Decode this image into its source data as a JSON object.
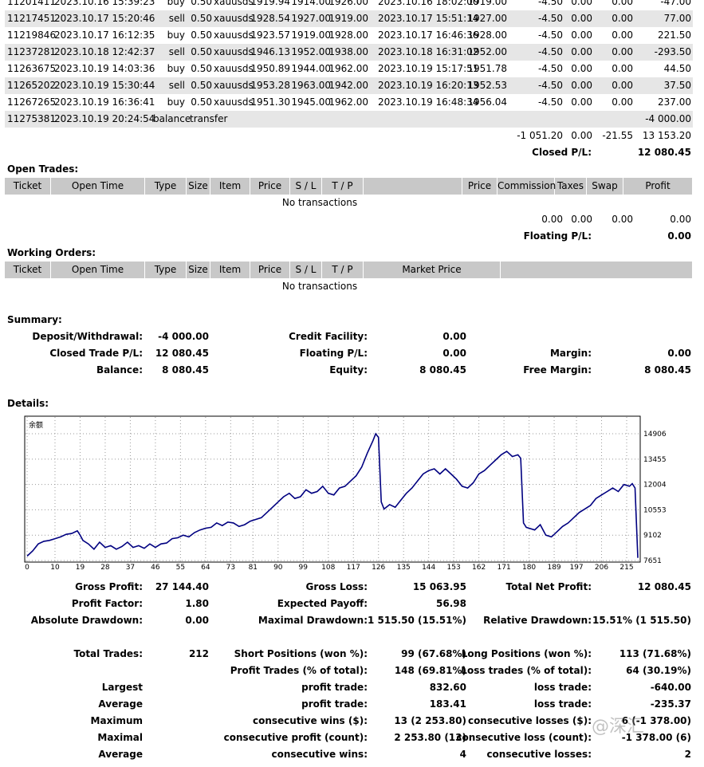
{
  "closed_rows": [
    [
      "11201411",
      "2023.10.16 15:39:23",
      "buy",
      "0.50",
      "xauusds",
      "1919.94",
      "1914.00",
      "1926.00",
      "2023.10.16 18:02:00",
      "1919.00",
      "-4.50",
      "0.00",
      "0.00",
      "-47.00"
    ],
    [
      "11217451",
      "2023.10.17 15:20:46",
      "sell",
      "0.50",
      "xauusds",
      "1928.54",
      "1927.00",
      "1919.00",
      "2023.10.17 15:51:14",
      "1927.00",
      "-4.50",
      "0.00",
      "0.00",
      "77.00"
    ],
    [
      "11219846",
      "2023.10.17 16:12:35",
      "buy",
      "0.50",
      "xauusds",
      "1923.57",
      "1919.00",
      "1928.00",
      "2023.10.17 16:46:36",
      "1928.00",
      "-4.50",
      "0.00",
      "0.00",
      "221.50"
    ],
    [
      "11237281",
      "2023.10.18 12:42:37",
      "sell",
      "0.50",
      "xauusds",
      "1946.13",
      "1952.00",
      "1938.00",
      "2023.10.18 16:31:02",
      "1952.00",
      "-4.50",
      "0.00",
      "0.00",
      "-293.50"
    ],
    [
      "11263675",
      "2023.10.19 14:03:36",
      "buy",
      "0.50",
      "xauusds",
      "1950.89",
      "1944.00",
      "1962.00",
      "2023.10.19 15:17:51",
      "1951.78",
      "-4.50",
      "0.00",
      "0.00",
      "44.50"
    ],
    [
      "11265202",
      "2023.10.19 15:30:44",
      "sell",
      "0.50",
      "xauusds",
      "1953.28",
      "1963.00",
      "1942.00",
      "2023.10.19 16:20:13",
      "1952.53",
      "-4.50",
      "0.00",
      "0.00",
      "37.50"
    ],
    [
      "11267265",
      "2023.10.19 16:36:41",
      "buy",
      "0.50",
      "xauusds",
      "1951.30",
      "1945.00",
      "1962.00",
      "2023.10.19 16:48:34",
      "1956.04",
      "-4.50",
      "0.00",
      "0.00",
      "237.00"
    ]
  ],
  "balance_row": {
    "ticket": "11275381",
    "time": "2023.10.19 20:24:54",
    "type": "balance",
    "item": "transfer",
    "profit": "-4 000.00"
  },
  "closed_totals": {
    "commission": "-1 051.20",
    "taxes": "0.00",
    "swap": "-21.55",
    "profit": "13 153.20"
  },
  "closed_pl": {
    "label": "Closed P/L:",
    "value": "12 080.45"
  },
  "open_trades": {
    "title": "Open Trades:",
    "headers": [
      "Ticket",
      "Open Time",
      "Type",
      "Size",
      "Item",
      "Price",
      "S / L",
      "T / P",
      "",
      "Price",
      "Commission",
      "Taxes",
      "Swap",
      "Profit"
    ],
    "empty": "No transactions",
    "totals": {
      "commission": "0.00",
      "taxes": "0.00",
      "swap": "0.00",
      "profit": "0.00"
    },
    "floating_label": "Floating P/L:",
    "floating_value": "0.00"
  },
  "working_orders": {
    "title": "Working Orders:",
    "headers": [
      "Ticket",
      "Open Time",
      "Type",
      "Size",
      "Item",
      "Price",
      "S / L",
      "T / P",
      "Market Price",
      ""
    ],
    "empty": "No transactions"
  },
  "summary": {
    "title": "Summary:",
    "deposit_label": "Deposit/Withdrawal:",
    "deposit": "-4 000.00",
    "credit_label": "Credit Facility:",
    "credit": "0.00",
    "closed_label": "Closed Trade P/L:",
    "closed": "12 080.45",
    "floating_label": "Floating P/L:",
    "floating": "0.00",
    "margin_label": "Margin:",
    "margin": "0.00",
    "balance_label": "Balance:",
    "balance": "8 080.45",
    "equity_label": "Equity:",
    "equity": "8 080.45",
    "free_margin_label": "Free Margin:",
    "free_margin": "8 080.45"
  },
  "details_title": "Details:",
  "chart_data": {
    "type": "line",
    "title": "余额",
    "y_ticks": [
      "14906",
      "13455",
      "12004",
      "10553",
      "9102",
      "7651"
    ],
    "y_tick_values": [
      14906,
      13455,
      12004,
      10553,
      9102,
      7651
    ],
    "x_ticks": [
      "0",
      "10",
      "19",
      "28",
      "37",
      "46",
      "55",
      "64",
      "73",
      "81",
      "90",
      "99",
      "108",
      "117",
      "126",
      "135",
      "144",
      "153",
      "162",
      "171",
      "180",
      "189",
      "197",
      "206",
      "215"
    ],
    "ylim": [
      7651,
      15500
    ],
    "xlim": [
      0,
      219
    ],
    "color": "#000080",
    "series": [
      {
        "x": [
          0,
          2,
          4,
          6,
          8,
          10,
          12,
          14,
          16,
          18,
          19,
          20,
          22,
          24,
          26,
          28,
          30,
          32,
          34,
          36,
          38,
          40,
          42,
          44,
          46,
          48,
          50,
          52,
          54,
          56,
          58,
          60,
          62,
          64,
          66,
          68,
          70,
          72,
          74,
          76,
          78,
          80,
          82,
          84,
          86,
          88,
          90,
          92,
          94,
          96,
          98,
          100,
          102,
          104,
          106,
          108,
          110,
          112,
          114,
          116,
          118,
          120,
          122,
          124,
          125,
          126,
          127,
          128,
          130,
          132,
          134,
          136,
          138,
          140,
          142,
          144,
          146,
          148,
          150,
          152,
          154,
          156,
          158,
          160,
          162,
          164,
          166,
          168,
          170,
          172,
          174,
          176,
          177,
          178,
          179,
          180,
          182,
          184,
          186,
          188,
          190,
          192,
          194,
          196,
          198,
          200,
          202,
          204,
          206,
          208,
          210,
          212,
          214,
          216,
          217,
          218,
          219
        ],
        "y": [
          7900,
          8200,
          8600,
          8750,
          8800,
          8900,
          9000,
          9150,
          9200,
          9350,
          9100,
          8800,
          8600,
          8300,
          8700,
          8400,
          8500,
          8300,
          8450,
          8700,
          8400,
          8500,
          8350,
          8600,
          8400,
          8600,
          8650,
          8900,
          8950,
          9100,
          9000,
          9250,
          9400,
          9500,
          9550,
          9800,
          9650,
          9850,
          9800,
          9600,
          9700,
          9900,
          10000,
          10100,
          10400,
          10700,
          11000,
          11300,
          11500,
          11200,
          11300,
          11700,
          11500,
          11600,
          11900,
          11500,
          11400,
          11800,
          11900,
          12200,
          12500,
          13000,
          13800,
          14500,
          14900,
          14700,
          11000,
          10600,
          10850,
          10700,
          11100,
          11500,
          11800,
          12200,
          12600,
          12800,
          12900,
          12600,
          12900,
          12600,
          12300,
          11900,
          11800,
          12100,
          12600,
          12800,
          13100,
          13400,
          13700,
          13900,
          13600,
          13700,
          13500,
          9800,
          9550,
          9500,
          9400,
          9700,
          9100,
          9000,
          9300,
          9600,
          9800,
          10100,
          10400,
          10600,
          10800,
          11200,
          11400,
          11600,
          11800,
          11600,
          12000,
          11900,
          12050,
          11800,
          7800
        ]
      }
    ]
  },
  "stats": {
    "gross_profit_label": "Gross Profit:",
    "gross_profit": "27 144.40",
    "gross_loss_label": "Gross Loss:",
    "gross_loss": "15 063.95",
    "total_net_profit_label": "Total Net Profit:",
    "total_net_profit": "12 080.45",
    "profit_factor_label": "Profit Factor:",
    "profit_factor": "1.80",
    "expected_payoff_label": "Expected Payoff:",
    "expected_payoff": "56.98",
    "absolute_drawdown_label": "Absolute Drawdown:",
    "absolute_drawdown": "0.00",
    "maximal_drawdown_label": "Maximal Drawdown:",
    "maximal_drawdown": "1 515.50 (15.51%)",
    "relative_drawdown_label": "Relative Drawdown:",
    "relative_drawdown": "15.51% (1 515.50)",
    "total_trades_label": "Total Trades:",
    "total_trades": "212",
    "short_positions_label": "Short Positions (won %):",
    "short_positions": "99 (67.68%)",
    "long_positions_label": "Long Positions (won %):",
    "long_positions": "113 (71.68%)",
    "profit_trades_label": "Profit Trades (% of total):",
    "profit_trades": "148 (69.81%)",
    "loss_trades_label": "Loss trades (% of total):",
    "loss_trades": "64 (30.19%)",
    "largest_label": "Largest",
    "largest_profit_label": "profit trade:",
    "largest_profit": "832.60",
    "largest_loss_label": "loss trade:",
    "largest_loss": "-640.00",
    "average_label": "Average",
    "average_profit_label": "profit trade:",
    "average_profit": "183.41",
    "average_loss_label": "loss trade:",
    "average_loss": "-235.37",
    "maximum_label": "Maximum",
    "max_cons_wins_label": "consecutive wins ($):",
    "max_cons_wins": "13 (2 253.80)",
    "max_cons_losses_label": "consecutive losses ($):",
    "max_cons_losses": "6 (-1 378.00)",
    "maximal_label": "Maximal",
    "maximal_cons_profit_label": "consecutive profit (count):",
    "maximal_cons_profit": "2 253.80 (13)",
    "maximal_cons_loss_label": "consecutive loss (count):",
    "maximal_cons_loss": "-1 378.00 (6)",
    "average2_label": "Average",
    "avg_cons_wins_label": "consecutive wins:",
    "avg_cons_wins": "4",
    "avg_cons_losses_label": "consecutive losses:",
    "avg_cons_losses": "2"
  },
  "watermark": "@深汇"
}
